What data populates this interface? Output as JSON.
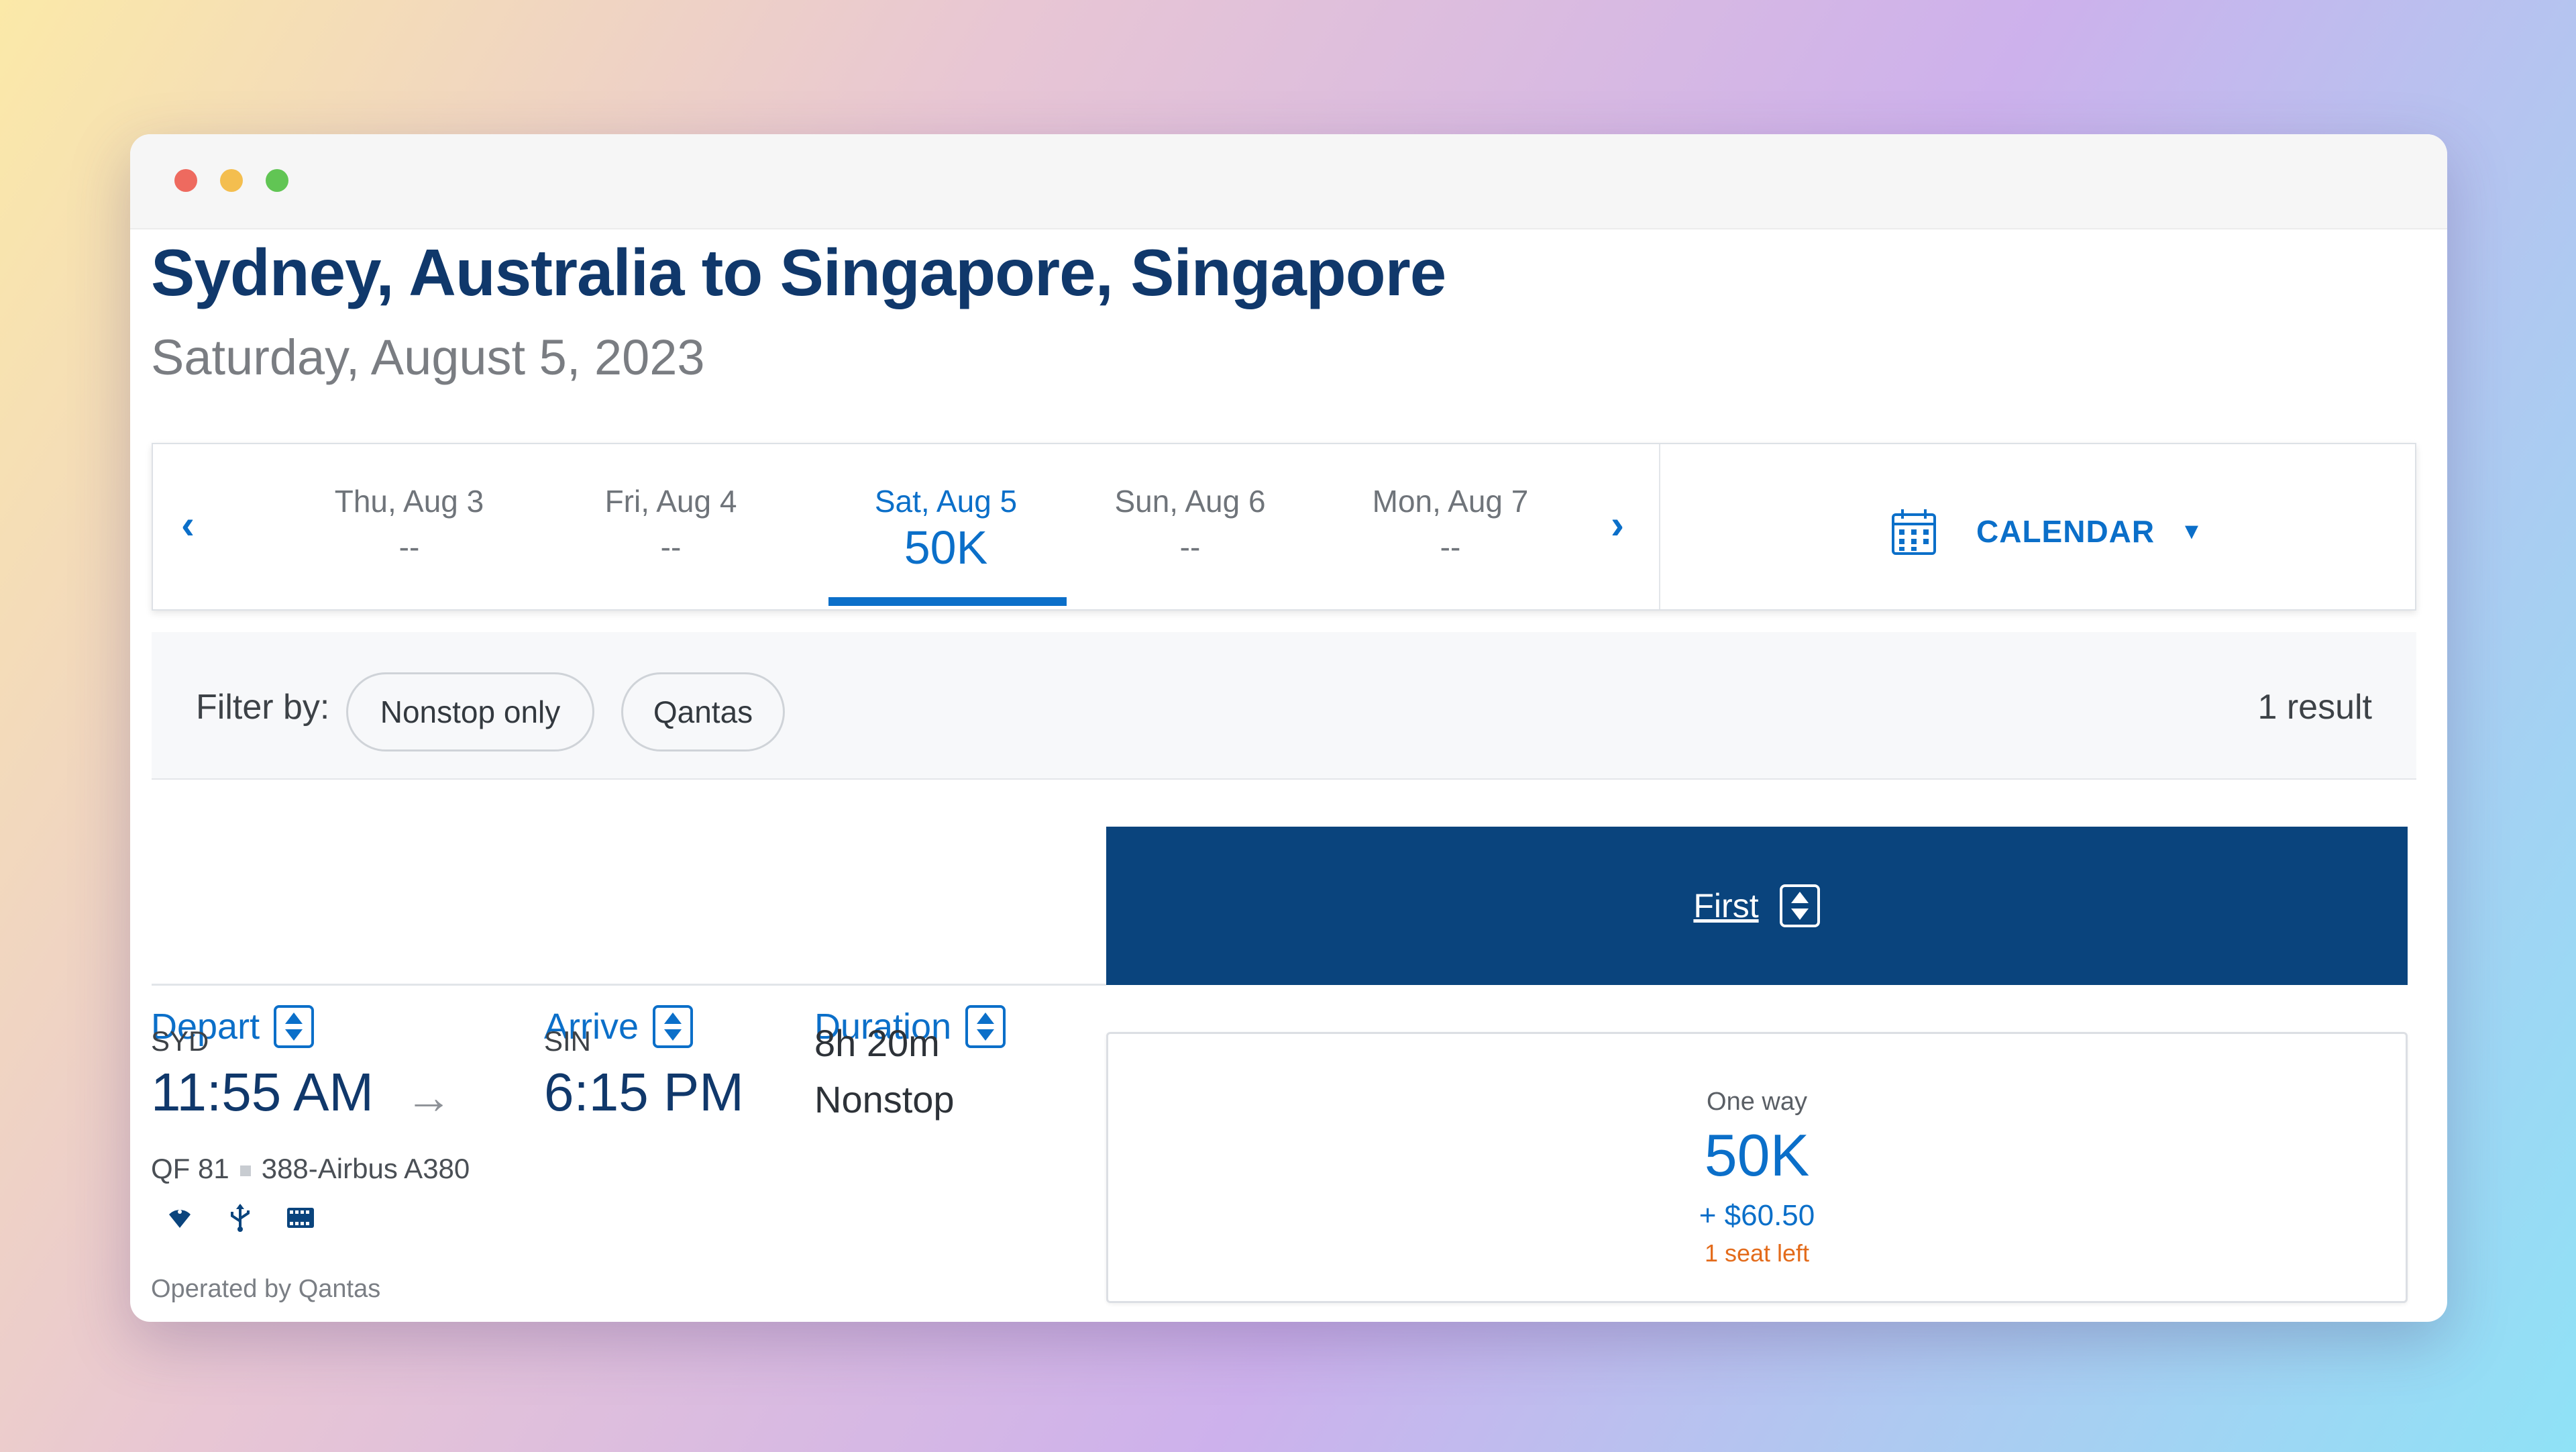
{
  "window": {
    "controls": [
      "close",
      "minimize",
      "zoom"
    ]
  },
  "route": {
    "title": "Sydney, Australia to Singapore, Singapore",
    "date": "Saturday, August 5, 2023"
  },
  "date_strip": {
    "prev_icon": "chevron-left-icon",
    "next_icon": "chevron-right-icon",
    "days": [
      {
        "label": "Thu, Aug 3",
        "value": "--",
        "active": false
      },
      {
        "label": "Fri, Aug 4",
        "value": "--",
        "active": false
      },
      {
        "label": "Sat, Aug 5",
        "value": "50K",
        "active": true
      },
      {
        "label": "Sun, Aug 6",
        "value": "--",
        "active": false
      },
      {
        "label": "Mon, Aug 7",
        "value": "--",
        "active": false
      }
    ],
    "calendar_label": "CALENDAR",
    "calendar_icon": "calendar-icon"
  },
  "filters": {
    "label": "Filter by:",
    "pills": [
      "Nonstop only",
      "Qantas"
    ],
    "result_count": "1 result"
  },
  "columns": {
    "depart": "Depart",
    "arrive": "Arrive",
    "duration": "Duration",
    "cabin": "First"
  },
  "flight": {
    "depart_code": "SYD",
    "depart_time": "11:55 AM",
    "arrive_code": "SIN",
    "arrive_time": "6:15 PM",
    "flight_number": "QF 81",
    "aircraft": "388-Airbus A380",
    "duration": "8h 20m",
    "stops": "Nonstop",
    "amenities": [
      "wifi-icon",
      "usb-power-icon",
      "entertainment-icon"
    ],
    "operated_by": "Operated by Qantas",
    "fare": {
      "type": "One way",
      "miles": "50K",
      "tax": "+ $60.50",
      "seats": "1 seat left"
    }
  },
  "colors": {
    "primary_blue": "#0b6fc9",
    "navy": "#0a447d",
    "title_navy": "#10386b",
    "warning_orange": "#e36b1b"
  }
}
